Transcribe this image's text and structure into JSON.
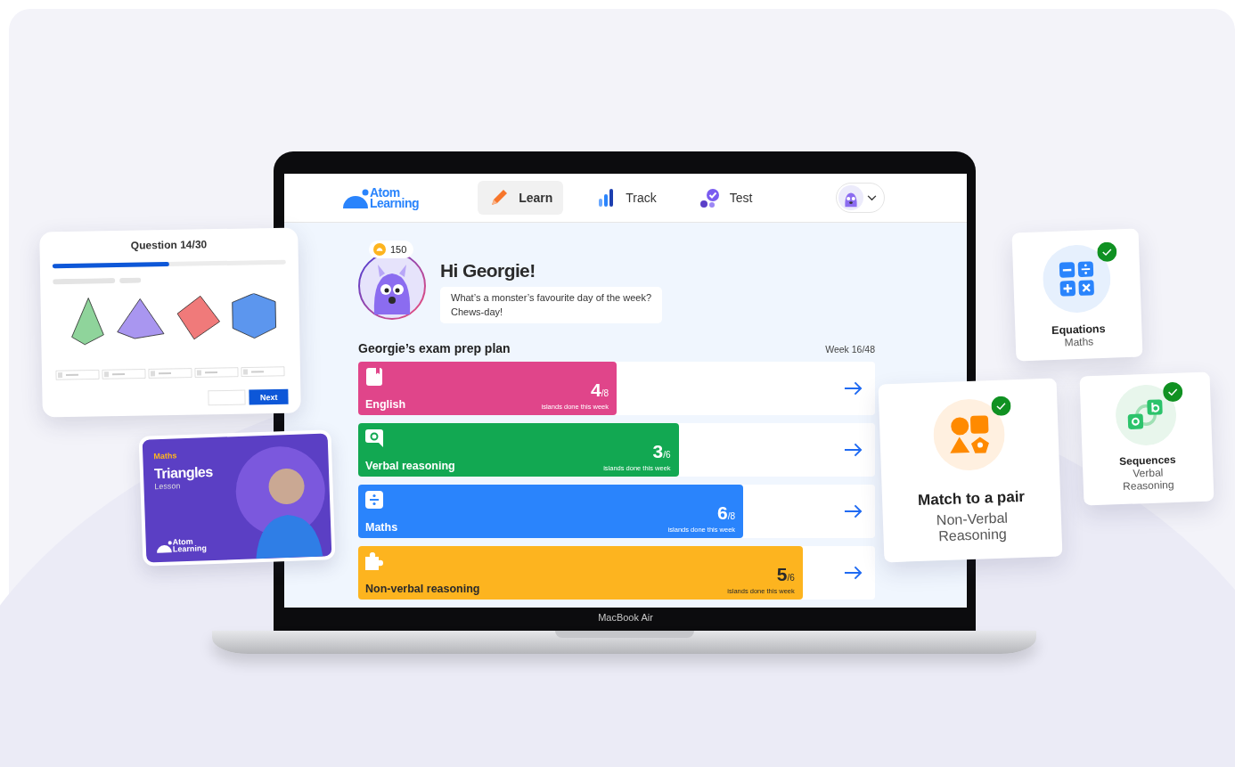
{
  "nav": {
    "logo": [
      "Atom",
      "Learning"
    ],
    "tabs": [
      {
        "label": "Learn",
        "kind": "pencil",
        "selected": true
      },
      {
        "label": "Track",
        "kind": "bars",
        "selected": false
      },
      {
        "label": "Test",
        "kind": "checks",
        "selected": false
      }
    ]
  },
  "greeting": {
    "coins": "150",
    "title": "Hi Georgie!",
    "joke": [
      "What’s a monster’s favourite day of the week?",
      "Chews-day!"
    ]
  },
  "plan": {
    "title": "Georgie’s exam prep plan",
    "week": "Week 16/48",
    "subjects": [
      {
        "name": "English",
        "kind": "book",
        "color": "#e0458a",
        "done": "4",
        "total": "/8",
        "caption": "islands done this week",
        "level": 0.5
      },
      {
        "name": "Verbal reasoning",
        "kind": "speech",
        "color": "#12a852",
        "done": "3",
        "total": "/6",
        "caption": "islands done this week",
        "level": 0.62
      },
      {
        "name": "Maths",
        "kind": "divide",
        "color": "#2a84fc",
        "done": "6",
        "total": "/8",
        "caption": "islands done this week",
        "level": 0.745
      },
      {
        "name": "Non-verbal reasoning",
        "kind": "puzzle",
        "color": "#fdb41f",
        "done": "5",
        "total": "/6",
        "caption": "islands done this week",
        "level": 0.86
      }
    ]
  },
  "laptop_label": "MacBook Air",
  "question_card": {
    "title": "Question 14/30",
    "level": 0.5,
    "button": "Next"
  },
  "lesson_card": {
    "subject": "Maths",
    "title": "Triangles",
    "type": "Lesson",
    "logo": [
      "Atom",
      "Learning"
    ]
  },
  "topic_cards": [
    {
      "title": "Equations",
      "subject": "Maths",
      "kind": "operators",
      "completed": true
    },
    {
      "title": "Match to a pair",
      "subject": "Non-Verbal Reasoning",
      "kind": "shapes",
      "completed": true
    },
    {
      "title": "Sequences",
      "subject": "Verbal Reasoning",
      "kind": "links",
      "completed": true
    }
  ]
}
